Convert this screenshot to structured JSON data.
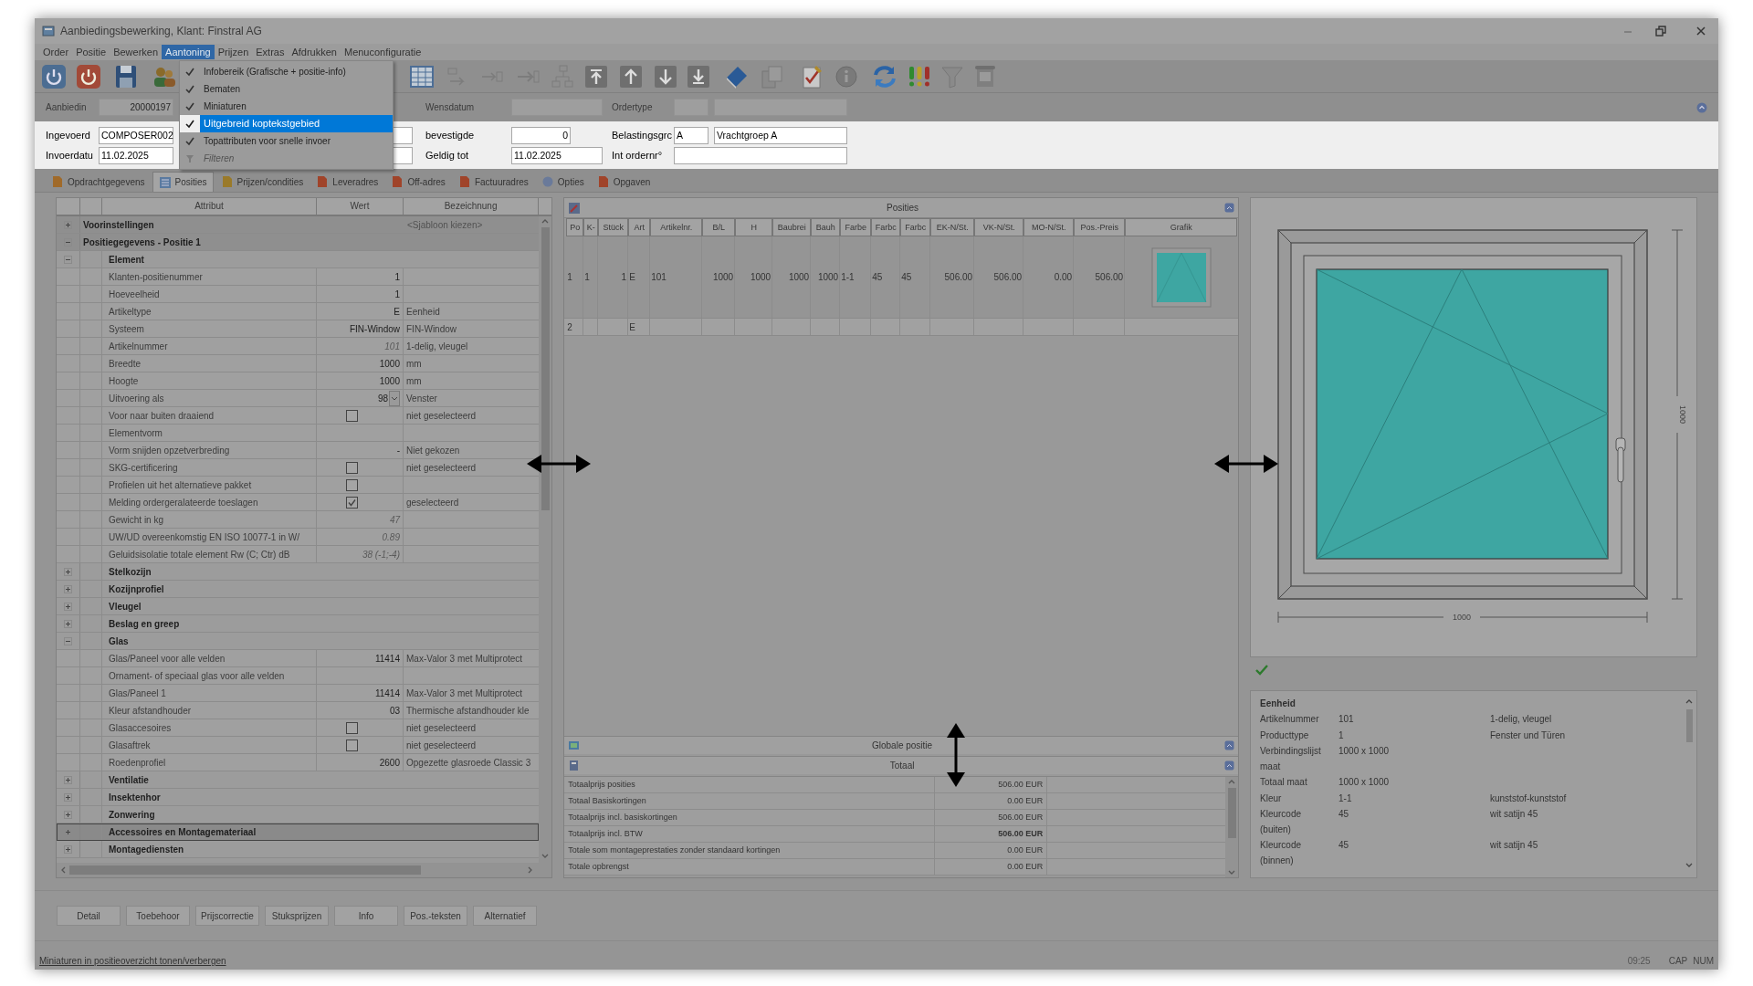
{
  "window": {
    "title": "Aanbiedingsbewerking, Klant: Finstral AG",
    "menus": [
      {
        "label": "Order",
        "selected": false
      },
      {
        "label": "Positie",
        "selected": false
      },
      {
        "label": "Bewerken",
        "selected": false
      },
      {
        "label": "Aantoning",
        "selected": true
      },
      {
        "label": "Prijzen",
        "selected": false
      },
      {
        "label": "Extras",
        "selected": false
      },
      {
        "label": "Afdrukken",
        "selected": false
      },
      {
        "label": "Menuconfiguratie",
        "selected": false
      }
    ]
  },
  "dropdown_menu": {
    "items": [
      {
        "label": "Infobereik (Grafische + positie-info)",
        "checked": true,
        "selected": false,
        "disabled": false
      },
      {
        "label": "Bematen",
        "checked": true,
        "selected": false,
        "disabled": false
      },
      {
        "label": "Miniaturen",
        "checked": true,
        "selected": false,
        "disabled": false
      },
      {
        "label": "Uitgebreid koptekstgebied",
        "checked": true,
        "selected": true,
        "disabled": false
      },
      {
        "label": "Topattributen voor snelle invoer",
        "checked": true,
        "selected": false,
        "disabled": false
      },
      {
        "label": "Filteren",
        "checked": false,
        "selected": false,
        "disabled": true
      }
    ]
  },
  "header": {
    "rows": [
      [
        {
          "kind": "label",
          "text": "Aanbiedin"
        },
        {
          "kind": "field",
          "value": "20000197"
        },
        null,
        {
          "kind": "label",
          "text": "Wensdatum"
        },
        {
          "kind": "field"
        },
        {
          "kind": "label",
          "text": "Ordertype"
        },
        {
          "kind": "field"
        },
        {
          "kind": "field"
        }
      ],
      [
        {
          "kind": "label",
          "text": "Ingevoerd"
        },
        {
          "kind": "field",
          "value": "COMPOSER002"
        },
        {
          "kind": "field"
        },
        {
          "kind": "label",
          "text": "bevestigde"
        },
        {
          "kind": "field",
          "value": "0"
        },
        {
          "kind": "label",
          "text": "Belastingsgrc"
        },
        {
          "kind": "field",
          "value": "A"
        },
        {
          "kind": "field",
          "value": "Vrachtgroep A"
        }
      ],
      [
        {
          "kind": "label",
          "text": "Invoerdatu"
        },
        {
          "kind": "field",
          "value": "11.02.2025"
        },
        {
          "kind": "field"
        },
        {
          "kind": "label",
          "text": "Geldig tot"
        },
        {
          "kind": "field",
          "value": "11.02.2025"
        },
        {
          "kind": "label",
          "text": "Int ordernr°"
        },
        {
          "kind": "field"
        },
        null
      ]
    ]
  },
  "tabs": [
    {
      "label": "Opdrachtgegevens",
      "selected": false
    },
    {
      "label": "Posities",
      "selected": true
    },
    {
      "label": "Prijzen/condities",
      "selected": false
    },
    {
      "label": "Leveradres",
      "selected": false
    },
    {
      "label": "Off-adres",
      "selected": false
    },
    {
      "label": "Factuuradres",
      "selected": false
    },
    {
      "label": "Opties",
      "selected": false
    },
    {
      "label": "Opgaven",
      "selected": false
    }
  ],
  "attribute_tree": {
    "columns": [
      "Attribut",
      "Wert",
      "Bezeichnung"
    ],
    "nodes": [
      {
        "kind": "group",
        "label": "Voorinstellingen",
        "description": "<Sjabloon kiezen>",
        "expanded": false,
        "selected": false
      },
      {
        "kind": "group",
        "label": "Positiegegevens - Positie 1",
        "expanded": true,
        "selected": false,
        "children": [
          {
            "kind": "group",
            "label": "Element",
            "expanded": true,
            "selected": false,
            "children": [
              {
                "kind": "text",
                "label": "Klanten-positienummer",
                "value": "1",
                "readonly": false
              },
              {
                "kind": "text",
                "label": "Hoeveelheid",
                "value": "1",
                "readonly": false
              },
              {
                "kind": "text",
                "label": "Artikeltype",
                "value": "E",
                "description": "Eenheid",
                "readonly": false
              },
              {
                "kind": "text",
                "label": "Systeem",
                "value": "FIN-Window",
                "description": "FIN-Window",
                "readonly": false
              },
              {
                "kind": "text",
                "label": "Artikelnummer",
                "value": "101",
                "description": "1-delig, vleugel",
                "readonly": true
              },
              {
                "kind": "text",
                "label": "Breedte",
                "value": "1000",
                "description": "mm",
                "readonly": false
              },
              {
                "kind": "text",
                "label": "Hoogte",
                "value": "1000",
                "description": "mm",
                "readonly": false
              },
              {
                "kind": "dropdown",
                "label": "Uitvoering als",
                "value": "98",
                "description": "Venster",
                "readonly": false
              },
              {
                "kind": "checkbox",
                "label": "Voor naar buiten draaiend",
                "checked": false,
                "description": "niet geselecteerd"
              },
              {
                "kind": "text",
                "label": "Elementvorm"
              },
              {
                "kind": "text",
                "label": "Vorm snijden opzetverbreding",
                "value": "-",
                "description": "Niet gekozen",
                "readonly": false
              },
              {
                "kind": "checkbox",
                "label": "SKG-certificering",
                "checked": false,
                "description": "niet geselecteerd"
              },
              {
                "kind": "checkbox",
                "label": "Profielen uit het alternatieve pakket",
                "checked": false
              },
              {
                "kind": "checkbox",
                "label": "Melding ordergeralateerde toeslagen",
                "checked": true,
                "description": "geselecteerd"
              },
              {
                "kind": "text",
                "label": "Gewicht in kg",
                "value": "47",
                "readonly": true
              },
              {
                "kind": "text",
                "label": "UW/UD overeenkomstig EN ISO 10077-1 in W/",
                "value": "0.89",
                "readonly": true
              },
              {
                "kind": "text",
                "label": "Geluidsisolatie totale element Rw (C; Ctr) dB",
                "value": "38 (-1;-4)",
                "readonly": true
              }
            ]
          },
          {
            "kind": "group",
            "label": "Stelkozijn",
            "expanded": false,
            "selected": false
          },
          {
            "kind": "group",
            "label": "Kozijnprofiel",
            "expanded": false,
            "selected": false
          },
          {
            "kind": "group",
            "label": "Vleugel",
            "expanded": false,
            "selected": false
          },
          {
            "kind": "group",
            "label": "Beslag en greep",
            "expanded": false,
            "selected": false
          },
          {
            "kind": "group",
            "label": "Glas",
            "expanded": true,
            "selected": false,
            "children": [
              {
                "kind": "text",
                "label": "Glas/Paneel voor alle velden",
                "value": "11414",
                "description": "Max-Valor 3 met Multiprotect",
                "readonly": false
              },
              {
                "kind": "text",
                "label": "Ornament- of speciaal glas voor alle velden"
              },
              {
                "kind": "text",
                "label": "Glas/Paneel 1",
                "value": "11414",
                "description": "Max-Valor 3 met Multiprotect",
                "readonly": false
              },
              {
                "kind": "text",
                "label": "Kleur afstandhouder",
                "value": "03",
                "description": "Thermische afstandhouder kle",
                "readonly": false
              },
              {
                "kind": "checkbox",
                "label": "Glasaccesoires",
                "checked": false,
                "description": "niet geselecteerd"
              },
              {
                "kind": "checkbox",
                "label": "Glasaftrek",
                "checked": false,
                "description": "niet geselecteerd"
              },
              {
                "kind": "text",
                "label": "Roedenprofiel",
                "value": "2600",
                "description": "Opgezette glasroede Classic 3",
                "readonly": false
              }
            ]
          },
          {
            "kind": "group",
            "label": "Ventilatie",
            "expanded": false,
            "selected": false
          },
          {
            "kind": "group",
            "label": "Insektenhor",
            "expanded": false,
            "selected": false
          },
          {
            "kind": "group",
            "label": "Zonwering",
            "expanded": false,
            "selected": false
          },
          {
            "kind": "group",
            "label": "Accessoires en Montagemateriaal",
            "expanded": false,
            "selected": true
          },
          {
            "kind": "group",
            "label": "Montagediensten",
            "expanded": false,
            "selected": false
          }
        ]
      }
    ]
  },
  "positions_table": {
    "title": "Posities",
    "columns": [
      "Po",
      "K-",
      "Stück",
      "Art",
      "Artikelnr.",
      "B/L",
      "H",
      "Baubrei",
      "Bauh",
      "Farbe",
      "Farbc",
      "Farbc",
      "EK-N/St.",
      "VK-N/St.",
      "MO-N/St.",
      "Pos.-Preis",
      "Grafik"
    ],
    "rows": [
      {
        "cells": [
          "1",
          "1",
          "1",
          "E",
          "101",
          "1000",
          "1000",
          "1000",
          "1000",
          "1-1",
          "45",
          "45",
          "506.00",
          "506.00",
          "0.00",
          "506.00"
        ],
        "has_graphic": true
      },
      {
        "cells": [
          "2",
          null,
          null,
          "E",
          null,
          null,
          null,
          null,
          null,
          null,
          null,
          null,
          null,
          null,
          null,
          null
        ],
        "has_graphic": false
      }
    ]
  },
  "section_bars": [
    "Globale positie",
    "Totaal"
  ],
  "totals": [
    {
      "label": "Totaalprijs posities",
      "value": "506.00 EUR",
      "bold": false
    },
    {
      "label": "Totaal Basiskortingen",
      "value": "0.00 EUR",
      "bold": false
    },
    {
      "label": "Totaalprijs incl. basiskortingen",
      "value": "506.00 EUR",
      "bold": false
    },
    {
      "label": "Totaalprijs incl. BTW",
      "value": "506.00 EUR",
      "bold": true
    },
    {
      "label": "Totale som montageprestaties zonder standaard kortingen",
      "value": "0.00 EUR",
      "bold": false
    },
    {
      "label": "Totale opbrengst",
      "value": "0.00 EUR",
      "bold": false
    }
  ],
  "drawing": {
    "width_label": "1000",
    "height_label": "1000"
  },
  "info": {
    "title": "Eenheid",
    "rows": [
      {
        "label": "Artikelnummer",
        "value": "101",
        "description": "1-delig, vleugel"
      },
      {
        "label": "Producttype",
        "value": "1",
        "description": "Fenster und Türen"
      },
      {
        "label": "Verbindingslijst maat",
        "value": "1000 x 1000"
      },
      {
        "label": "Totaal maat",
        "value": "1000 x 1000"
      },
      {
        "label": "Kleur",
        "value": "1-1",
        "description": "kunststof-kunststof"
      },
      {
        "label": "Kleurcode (buiten)",
        "value": "45",
        "description": "wit satijn 45"
      },
      {
        "label": "Kleurcode (binnen)",
        "value": "45",
        "description": "wit satijn 45"
      }
    ]
  },
  "buttons": [
    "Detail",
    "Toebehoor",
    "Prijscorrectie",
    "Stuksprijzen",
    "Info",
    "Pos.-teksten",
    "Alternatief"
  ],
  "status_bar": {
    "message": "Miniaturen in positieoverzicht tonen/verbergen",
    "time": "09:25",
    "indicators": [
      "CAP",
      "NUM"
    ]
  }
}
